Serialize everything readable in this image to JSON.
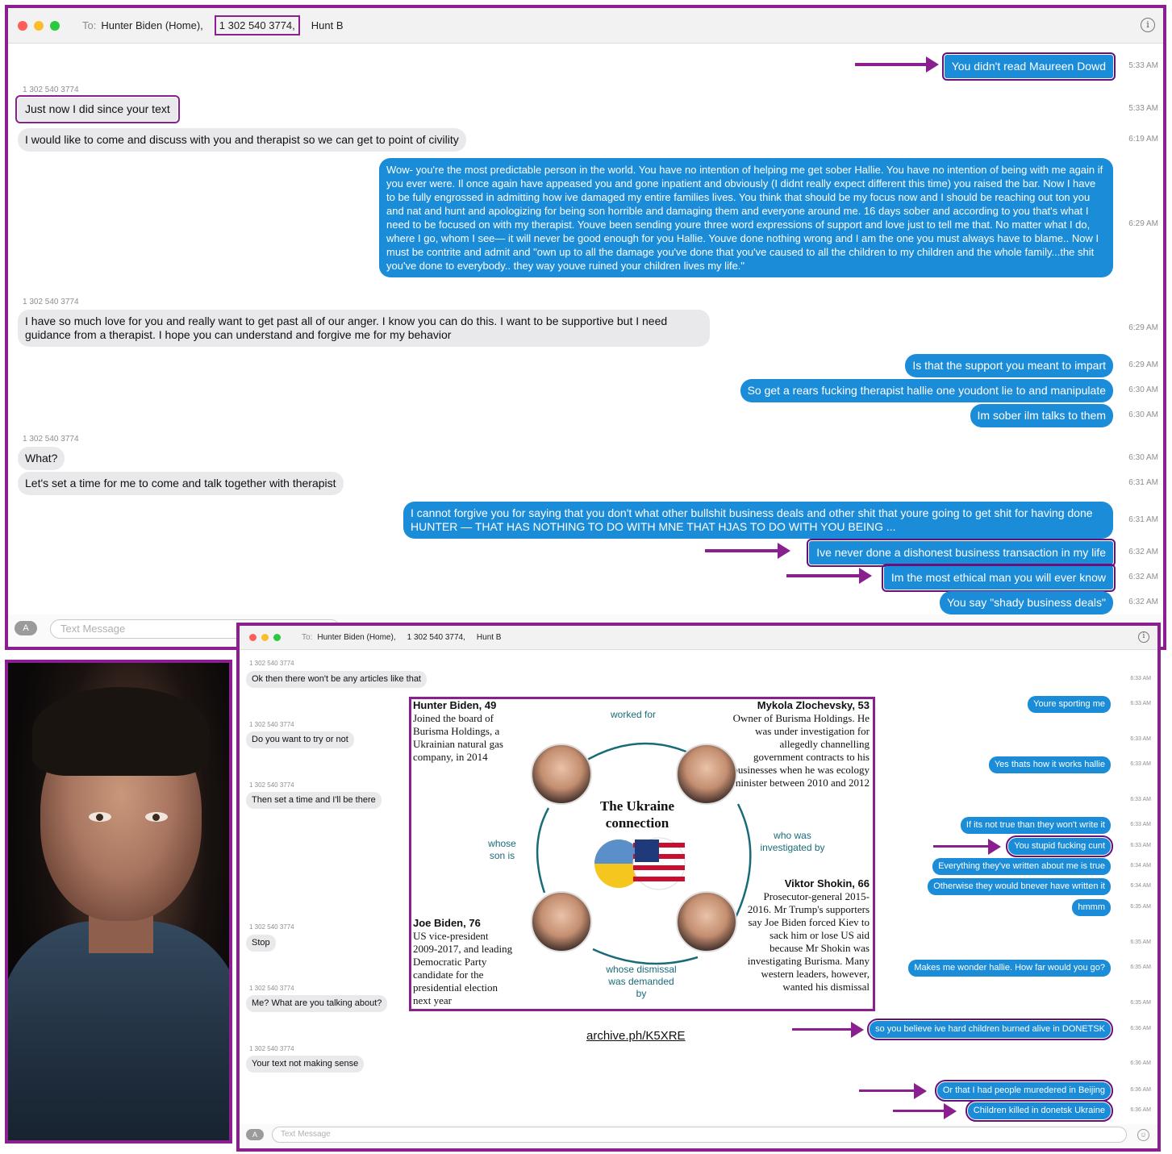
{
  "window1": {
    "to_label": "To:",
    "recipients": [
      "Hunter Biden (Home),",
      "1 302 540 3774,",
      "Hunt B"
    ],
    "input_placeholder": "Text Message",
    "messages": [
      {
        "dir": "out",
        "text": "You didn't read Maureen Dowd",
        "time": "5:33 AM",
        "highlight": true
      },
      {
        "dir": "in",
        "sender": "1 302 540 3774",
        "text": "Just now I did since your text",
        "time": "5:33 AM",
        "highlight": true
      },
      {
        "dir": "in",
        "text": "I would like to come and discuss with you and therapist so we can get to point of civility",
        "time": "6:19 AM"
      },
      {
        "dir": "out",
        "text": "Wow- you're the most predictable person in the world. You have no intention of helping me get sober Hallie.  You have no intention of being with me again if you ever were. Il once again have appeased you and gone inpatient and obviously (I didnt really expect different this time) you raised the bar.  Now I have to be fully engrossed in admitting how ive damaged my entire families lives. You think that should be my focus now and I should be reaching out ton you and nat and hunt and apologizing for being son horrible and damaging them and everyone around me.  16 days sober and according to you that's what I need to be focused on with my therapist.  Youve been sending youre three word expressions of support and love just to tell me that.  No matter what I do, where  I go, whom I see— it will never be good enough for you Hallie.  Youve done nothing wrong and I am the one you must always have to blame..  Now I must be contrite and admit and \"own up to all the damage you've done that you've caused to all the children to my children and the whole family...the shit you've done to everybody.. they way youve ruined your children lives my life.\"",
        "time": "6:29 AM"
      },
      {
        "dir": "in",
        "sender": "1 302 540 3774",
        "text": "I have so much love for you and really want to get past all of our anger. I know you can do this. I want to be supportive but I need guidance from a therapist. I hope you can understand and forgive me for my behavior",
        "time": "6:29 AM"
      },
      {
        "dir": "out",
        "text": "Is that the support you meant to impart",
        "time": "6:29 AM"
      },
      {
        "dir": "out",
        "text": "So get a rears fucking therapist hallie one youdont lie to and manipulate",
        "time": "6:30 AM"
      },
      {
        "dir": "out",
        "text": "Im sober ilm talks to them",
        "time": "6:30 AM"
      },
      {
        "dir": "in",
        "sender": "1 302 540 3774",
        "text": "What?",
        "time": "6:30 AM"
      },
      {
        "dir": "in",
        "text": "Let's set a time for me to come and talk together with therapist",
        "time": "6:31 AM"
      },
      {
        "dir": "out",
        "text": "I cannot forgive you for saying that you don't what other bullshit business deals and other shit that youre going to get shit for having done HUNTER — THAT HAS NOTHING TO DO WITH MNE THAT HJAS TO DO WITH YOU BEING ...",
        "time": "6:31 AM"
      },
      {
        "dir": "out",
        "text": "Ive never done a dishonest business transaction in my life",
        "time": "6:32 AM",
        "highlight": true
      },
      {
        "dir": "out",
        "text": "Im the most ethical man you will ever know",
        "time": "6:32 AM",
        "highlight": true
      },
      {
        "dir": "out",
        "text": "You say \"shady business deals\"",
        "time": "6:32 AM"
      }
    ]
  },
  "window2": {
    "to_label": "To:",
    "recipients": [
      "Hunter Biden (Home),",
      "1 302 540 3774,",
      "Hunt B"
    ],
    "input_placeholder": "Text Message",
    "messages_in": [
      {
        "sender": "1 302 540 3774",
        "text": "Ok then there won't be any articles like that",
        "time": "6:33 AM"
      },
      {
        "sender": "1 302 540 3774",
        "text": "Do you want to try or not",
        "time": "6:33 AM"
      },
      {
        "sender": "1 302 540 3774",
        "text": "Then set a time and I'll be there",
        "time": "6:33 AM"
      },
      {
        "sender": "1 302 540 3774",
        "text": "Stop",
        "time": "6:35 AM"
      },
      {
        "sender": "1 302 540 3774",
        "text": "Me? What are you talking about?",
        "time": "6:35 AM"
      },
      {
        "sender": "1 302 540 3774",
        "text": "Your text not making sense",
        "time": "6:36 AM"
      }
    ],
    "messages_out": [
      {
        "text": "Youre sporting me",
        "time": "6:33 AM"
      },
      {
        "text": "Yes thats how it works hallie",
        "time": "6:33 AM"
      },
      {
        "text": "If its not true than they won't write it",
        "time": "6:33 AM"
      },
      {
        "text": "You stupid fucking cunt",
        "time": "6:33 AM",
        "highlight": true
      },
      {
        "text": "Everything they've written about me is true",
        "time": "6:34 AM"
      },
      {
        "text": "Otherwise they would bnever have written it",
        "time": "6:34 AM"
      },
      {
        "text": "hmmm",
        "time": "6:35 AM"
      },
      {
        "text": "Makes me wonder hallie.  How far would you go?",
        "time": "6:35 AM"
      },
      {
        "text": "so you believe ive hard children burned alive in DONETSK",
        "time": "6:36 AM",
        "highlight": true
      },
      {
        "text": "Or that I had people muredered in Beijing",
        "time": "6:36 AM",
        "highlight": true
      },
      {
        "text": "Children killed in donetsk Ukraine",
        "time": "6:36 AM",
        "highlight": true
      }
    ],
    "infographic": {
      "title": "The Ukraine connection",
      "hunter": {
        "name": "Hunter Biden, 49",
        "desc": "Joined the board of Burisma Holdings, a Ukrainian natural gas company, in 2014"
      },
      "mykola": {
        "name": "Mykola Zlochevsky, 53",
        "desc": "Owner of Burisma Holdings. He was under investigation for allegedly channelling government contracts to his businesses when he was ecology minister between 2010 and 2012"
      },
      "joe": {
        "name": "Joe Biden, 76",
        "desc": "US vice-president 2009-2017, and leading Democratic Party candidate for the presidential election next year"
      },
      "viktor": {
        "name": "Viktor Shokin, 66",
        "desc": "Prosecutor-general 2015-2016. Mr Trump's supporters say Joe Biden forced Kiev to sack him or lose US aid because Mr Shokin was investigating Burisma. Many western leaders, however, wanted his dismissal"
      },
      "link_worked_for": "worked for",
      "link_investigated": "who was investigated by",
      "link_dismissal": "whose dismissal was demanded by",
      "link_son": "whose son is"
    },
    "archive_link": "archive.ph/K5XRE"
  },
  "colors": {
    "accent_purple": "#8a1f8f",
    "imessage_blue": "#1a8cd8",
    "incoming_gray": "#e9e9eb"
  }
}
